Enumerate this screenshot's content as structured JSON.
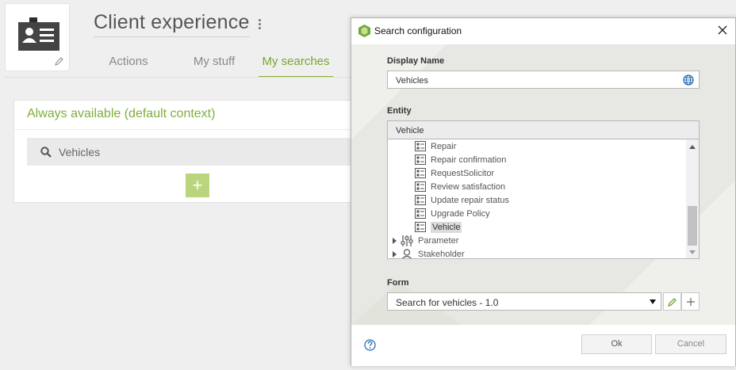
{
  "app": {
    "title": "Client experience",
    "tabs": [
      "Actions",
      "My stuff",
      "My searches"
    ],
    "active_tab": "My searches",
    "panel_title": "Always available (default context)",
    "search_items": [
      "Vehicles"
    ],
    "add_label": "+"
  },
  "dialog": {
    "title": "Search configuration",
    "display_name_label": "Display Name",
    "display_name_value": "Vehicles",
    "entity_label": "Entity",
    "entity_value": "Vehicle",
    "tree_items": [
      {
        "label": "Repair",
        "icon": "form-icon"
      },
      {
        "label": "Repair confirmation",
        "icon": "form-icon"
      },
      {
        "label": "RequestSolicitor",
        "icon": "form-icon"
      },
      {
        "label": "Review satisfaction",
        "icon": "form-icon"
      },
      {
        "label": "Update repair status",
        "icon": "form-icon"
      },
      {
        "label": "Upgrade Policy",
        "icon": "form-icon"
      },
      {
        "label": "Vehicle",
        "icon": "form-icon",
        "selected": true
      }
    ],
    "tree_groups": [
      {
        "label": "Parameter",
        "icon": "sliders-icon"
      },
      {
        "label": "Stakeholder",
        "icon": "person-icon"
      }
    ],
    "form_label": "Form",
    "form_value": "Search for vehicles - 1.0",
    "ok_label": "Ok",
    "cancel_label": "Cancel"
  },
  "colors": {
    "accent_green": "#7fae3b",
    "add_button": "#b9d57e"
  }
}
